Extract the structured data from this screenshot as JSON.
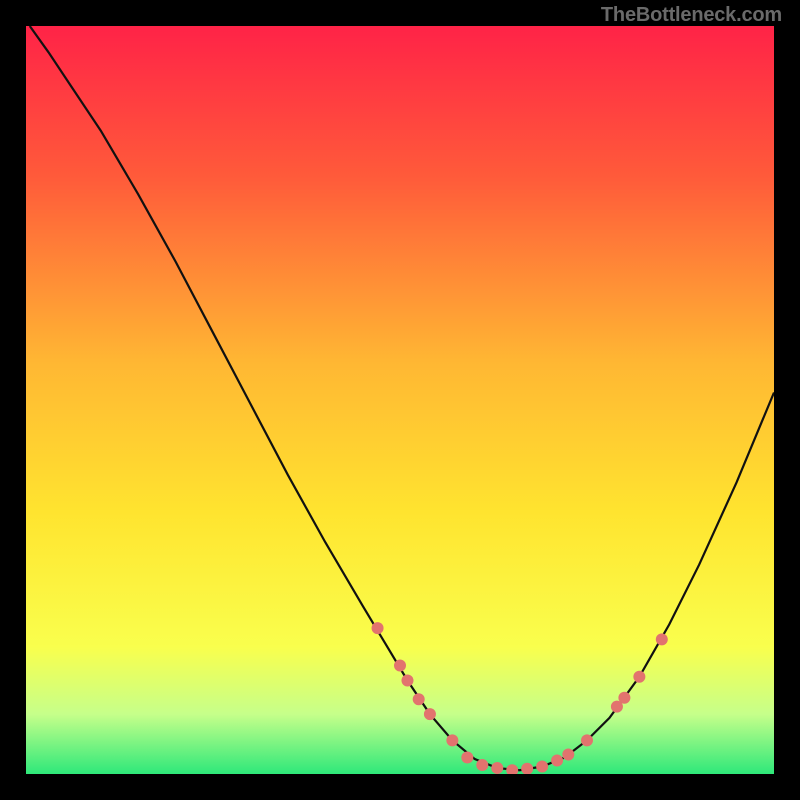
{
  "watermark": "TheBottleneck.com",
  "gradient_stops": [
    {
      "offset": "0%",
      "color": "#ff2347"
    },
    {
      "offset": "20%",
      "color": "#ff5a3a"
    },
    {
      "offset": "45%",
      "color": "#ffb733"
    },
    {
      "offset": "65%",
      "color": "#ffe42f"
    },
    {
      "offset": "83%",
      "color": "#f9ff4d"
    },
    {
      "offset": "92%",
      "color": "#c6ff8a"
    },
    {
      "offset": "100%",
      "color": "#2ee87a"
    }
  ],
  "chart_data": {
    "type": "line",
    "title": "",
    "xlabel": "",
    "ylabel": "",
    "xlim": [
      0,
      100
    ],
    "ylim": [
      0,
      100
    ],
    "curve": [
      {
        "x": 0.5,
        "y": 100
      },
      {
        "x": 3,
        "y": 96.5
      },
      {
        "x": 6,
        "y": 92
      },
      {
        "x": 10,
        "y": 86
      },
      {
        "x": 15,
        "y": 77.5
      },
      {
        "x": 20,
        "y": 68.5
      },
      {
        "x": 25,
        "y": 59
      },
      {
        "x": 30,
        "y": 49.5
      },
      {
        "x": 35,
        "y": 40
      },
      {
        "x": 40,
        "y": 31
      },
      {
        "x": 45,
        "y": 22.5
      },
      {
        "x": 48,
        "y": 17.5
      },
      {
        "x": 51,
        "y": 12.5
      },
      {
        "x": 54,
        "y": 8
      },
      {
        "x": 57,
        "y": 4.5
      },
      {
        "x": 60,
        "y": 2
      },
      {
        "x": 63,
        "y": 0.8
      },
      {
        "x": 66,
        "y": 0.5
      },
      {
        "x": 69,
        "y": 1
      },
      {
        "x": 72,
        "y": 2.2
      },
      {
        "x": 75,
        "y": 4.5
      },
      {
        "x": 78,
        "y": 7.5
      },
      {
        "x": 82,
        "y": 13
      },
      {
        "x": 86,
        "y": 20
      },
      {
        "x": 90,
        "y": 28
      },
      {
        "x": 95,
        "y": 39
      },
      {
        "x": 100,
        "y": 51
      }
    ],
    "points": [
      {
        "x": 47,
        "y": 19.5
      },
      {
        "x": 50,
        "y": 14.5
      },
      {
        "x": 51,
        "y": 12.5
      },
      {
        "x": 52.5,
        "y": 10
      },
      {
        "x": 54,
        "y": 8
      },
      {
        "x": 57,
        "y": 4.5
      },
      {
        "x": 59,
        "y": 2.2
      },
      {
        "x": 61,
        "y": 1.2
      },
      {
        "x": 63,
        "y": 0.8
      },
      {
        "x": 65,
        "y": 0.5
      },
      {
        "x": 67,
        "y": 0.7
      },
      {
        "x": 69,
        "y": 1
      },
      {
        "x": 71,
        "y": 1.8
      },
      {
        "x": 72.5,
        "y": 2.6
      },
      {
        "x": 75,
        "y": 4.5
      },
      {
        "x": 79,
        "y": 9
      },
      {
        "x": 80,
        "y": 10.2
      },
      {
        "x": 82,
        "y": 13
      },
      {
        "x": 85,
        "y": 18
      }
    ],
    "point_color": "#e2736e",
    "curve_color": "#111111",
    "point_radius": 6
  }
}
